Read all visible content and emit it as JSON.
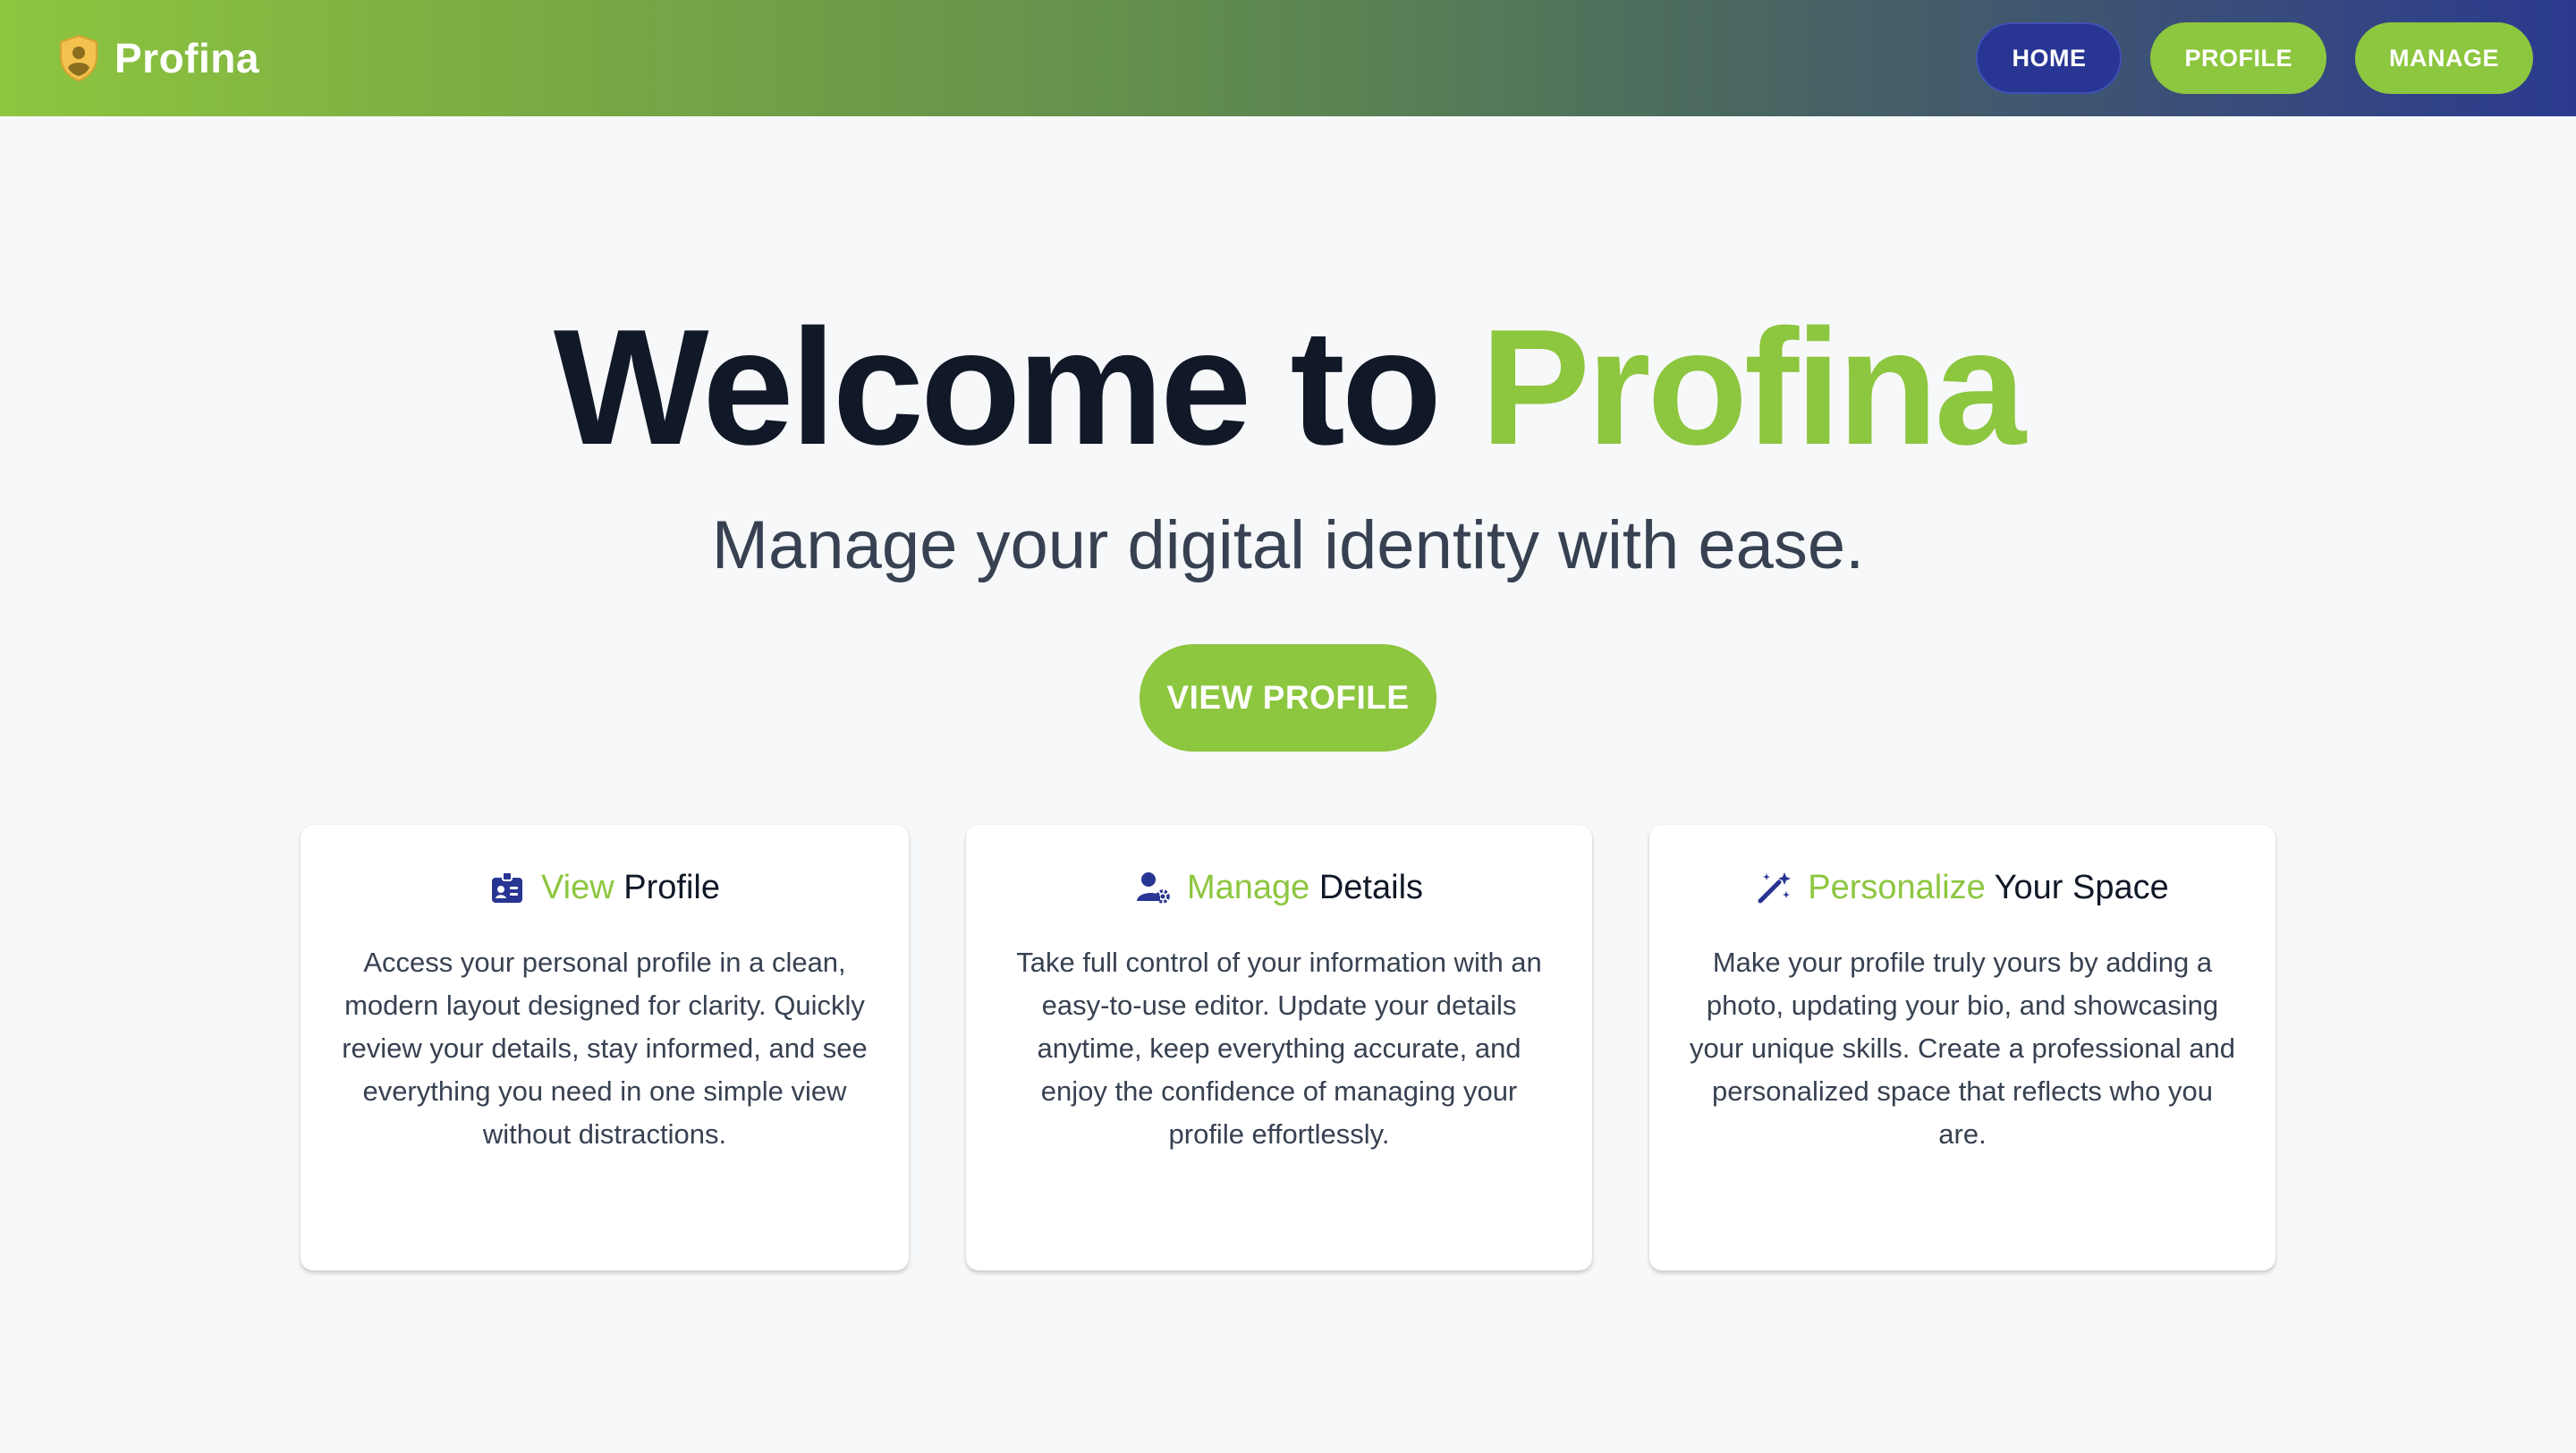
{
  "brand": {
    "name": "Profina",
    "logo_icon": "shield-user-icon"
  },
  "nav": [
    {
      "label": "HOME",
      "variant": "active"
    },
    {
      "label": "PROFILE",
      "variant": "green"
    },
    {
      "label": "MANAGE",
      "variant": "green"
    }
  ],
  "hero": {
    "title_prefix": "Welcome to",
    "title_accent": "Profina",
    "subtitle": "Manage your digital identity with ease.",
    "cta_label": "VIEW PROFILE"
  },
  "cards": [
    {
      "icon": "id-badge-icon",
      "title_accent": "View",
      "title_rest": "Profile",
      "body": "Access your personal profile in a clean, modern layout designed for clarity. Quickly review your details, stay informed, and see everything you need in one simple view without distractions."
    },
    {
      "icon": "user-gear-icon",
      "title_accent": "Manage",
      "title_rest": "Details",
      "body": "Take full control of your information with an easy-to-use editor. Update your details anytime, keep everything accurate, and enjoy the confidence of managing your profile effortlessly."
    },
    {
      "icon": "magic-wand-icon",
      "title_accent": "Personalize",
      "title_rest": "Your Space",
      "body": "Make your profile truly yours by adding a photo, updating your bio, and showcasing your unique skills. Create a professional and personalized space that reflects who you are."
    }
  ],
  "colors": {
    "accent_green": "#8dc63f",
    "navy": "#283593",
    "heading": "#111827",
    "body_text": "#374151",
    "background": "#f7f8fa"
  }
}
